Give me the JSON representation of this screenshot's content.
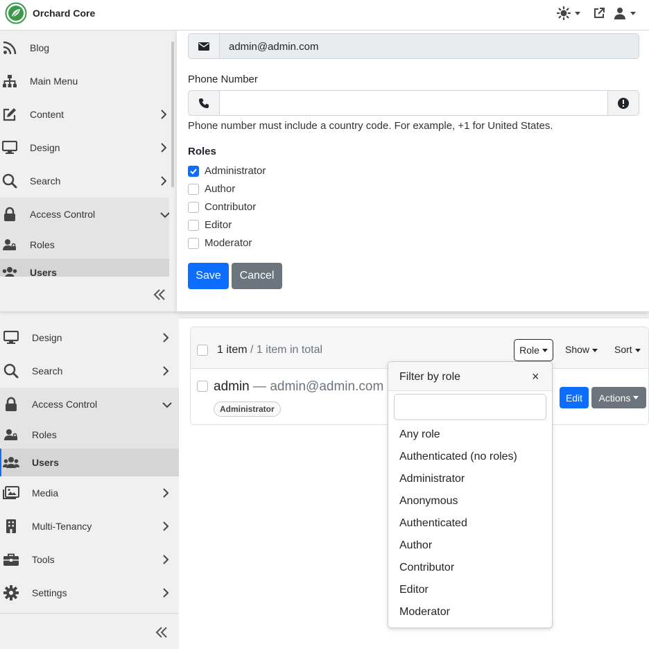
{
  "app": {
    "title": "Orchard Core"
  },
  "colors": {
    "primary": "#0d6efd",
    "secondary": "#6c757d",
    "brand": "#3a9a4a"
  },
  "top_nav": {
    "theme_icon": "sun-icon",
    "visit_icon": "external-link-icon",
    "user_icon": "user-icon"
  },
  "overlay_sidebar": {
    "items": [
      {
        "label": "Blog",
        "icon": "rss-icon"
      },
      {
        "label": "Main Menu",
        "icon": "sitemap-icon"
      },
      {
        "label": "Content",
        "icon": "edit-icon"
      },
      {
        "label": "Design",
        "icon": "monitor-icon"
      },
      {
        "label": "Search",
        "icon": "search-icon"
      },
      {
        "label": "Access Control",
        "icon": "lock-icon"
      },
      {
        "label": "Roles",
        "icon": "user-lock-icon"
      },
      {
        "label": "Users",
        "icon": "users-icon"
      }
    ]
  },
  "form": {
    "email_value": "admin@admin.com",
    "phone_label": "Phone Number",
    "phone_value": "",
    "phone_help": "Phone number must include a country code. For example, +1 for United States.",
    "roles_label": "Roles",
    "roles": [
      {
        "label": "Administrator",
        "checked": true
      },
      {
        "label": "Author",
        "checked": false
      },
      {
        "label": "Contributor",
        "checked": false
      },
      {
        "label": "Editor",
        "checked": false
      },
      {
        "label": "Moderator",
        "checked": false
      }
    ],
    "save_label": "Save",
    "cancel_label": "Cancel"
  },
  "bg_sidebar": {
    "items": [
      {
        "label": "Design",
        "icon": "monitor-icon"
      },
      {
        "label": "Search",
        "icon": "search-icon"
      },
      {
        "label": "Access Control",
        "icon": "lock-icon"
      },
      {
        "label": "Roles",
        "icon": "user-lock-icon"
      },
      {
        "label": "Users",
        "icon": "users-icon"
      },
      {
        "label": "Media",
        "icon": "images-icon"
      },
      {
        "label": "Multi-Tenancy",
        "icon": "building-icon"
      },
      {
        "label": "Tools",
        "icon": "toolbox-icon"
      },
      {
        "label": "Settings",
        "icon": "gear-icon"
      }
    ]
  },
  "users_list": {
    "count": "1 item",
    "total": "/ 1 item in total",
    "role_label": "Role",
    "show_label": "Show",
    "sort_label": "Sort",
    "user_name": "admin",
    "user_sep": "—",
    "user_email": "admin@admin.com",
    "user_role_badge": "Administrator",
    "edit_label": "Edit",
    "actions_label": "Actions"
  },
  "role_filter": {
    "title": "Filter by role",
    "close": "×",
    "search_value": "",
    "options": [
      "Any role",
      "Authenticated (no roles)",
      "Administrator",
      "Anonymous",
      "Authenticated",
      "Author",
      "Contributor",
      "Editor",
      "Moderator"
    ]
  }
}
